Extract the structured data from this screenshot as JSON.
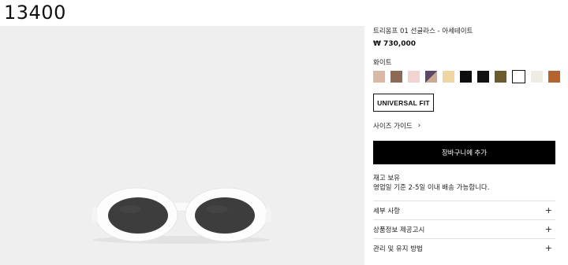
{
  "page_id": "13400",
  "product": {
    "title": "트리옹프 01 선글라스 - 아세테이트",
    "price": "₩ 730,000",
    "color_label": "화이트",
    "swatches": [
      {
        "name": "swatch-nude",
        "color": "#d9b8a6",
        "selected": false
      },
      {
        "name": "swatch-taupe",
        "color": "#8c6a55",
        "selected": false
      },
      {
        "name": "swatch-blush",
        "color": "#f1d4cf",
        "selected": false
      },
      {
        "name": "swatch-purple-split",
        "color": "#5b4867",
        "color2": "#c9a990",
        "selected": false
      },
      {
        "name": "swatch-beige",
        "color": "#efd6a2",
        "selected": false
      },
      {
        "name": "swatch-black",
        "color": "#0d0d0d",
        "selected": false
      },
      {
        "name": "swatch-black-2",
        "color": "#111111",
        "selected": false
      },
      {
        "name": "swatch-olive",
        "color": "#6b5a2b",
        "selected": false
      },
      {
        "name": "swatch-white",
        "color": "#ffffff",
        "selected": true
      },
      {
        "name": "swatch-ivory",
        "color": "#eeece4",
        "selected": false
      },
      {
        "name": "swatch-cognac",
        "color": "#b5632f",
        "selected": false
      }
    ],
    "fit_label": "UNIVERSAL FIT",
    "size_guide_label": "사이즈 가이드",
    "size_guide_icon": "chevron-right-icon",
    "cart_label": "장바구니에 추가",
    "stock_line1": "재고 보유",
    "stock_line2": "영업일 기준 2-5일 이내 배송 가능합니다.",
    "accordion": [
      {
        "label": "세부 사항",
        "icon": "+"
      },
      {
        "label": "상품정보 제공고시",
        "icon": "+"
      },
      {
        "label": "관리 및 유지 방법",
        "icon": "+"
      }
    ]
  },
  "colors": {
    "gallery_bg": "#efefef",
    "frame": "#ffffff",
    "lens": "#3d3d3d",
    "button_bg": "#000000",
    "button_text": "#ffffff"
  }
}
